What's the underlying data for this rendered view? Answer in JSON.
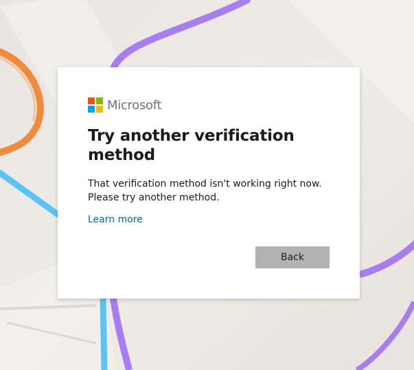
{
  "brand": {
    "name": "Microsoft",
    "logo_colors": [
      "#f25022",
      "#7fba00",
      "#00a4ef",
      "#ffb900"
    ]
  },
  "dialog": {
    "title": "Try another verification method",
    "description_line1": "That verification method isn't working right now.",
    "description_line2": "Please try another method.",
    "learn_more": "Learn more",
    "back_label": "Back"
  },
  "colors": {
    "link": "#0067b8",
    "button_bg": "#b2b2b2",
    "text": "#1b1b1b",
    "background": "#ece9e5"
  }
}
